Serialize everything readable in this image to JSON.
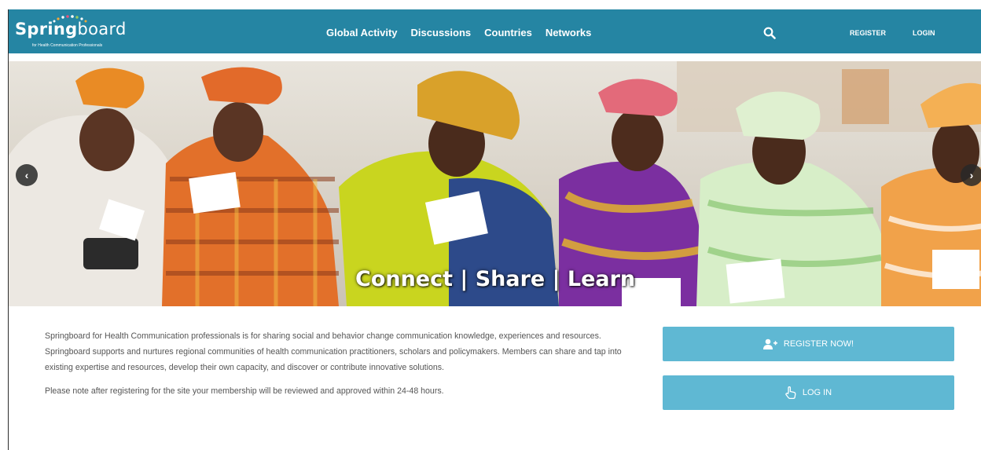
{
  "brand": {
    "logo_text_bold": "Spring",
    "logo_text_rest": "board",
    "tagline": "for Health Communication Professionals",
    "primary_color": "#2585a3",
    "button_color": "#5fb8d3"
  },
  "nav": {
    "items": [
      "Global Activity",
      "Discussions",
      "Countries",
      "Networks"
    ],
    "search_icon": "search-icon",
    "register_label": "REGISTER",
    "login_label": "LOGIN"
  },
  "hero": {
    "caption": "Connect | Share | Learn",
    "prev_icon": "chevron-left-icon",
    "next_icon": "chevron-right-icon"
  },
  "content": {
    "intro": "Springboard for Health Communication professionals is for sharing social and behavior change communication knowledge, experiences and resources. Springboard supports and nurtures regional communities of health communication practitioners, scholars and policymakers. Members can share and tap into existing expertise and resources, develop their own capacity, and discover or contribute innovative solutions.",
    "note": "Please note after registering for the site your membership will be reviewed and approved within 24-48 hours."
  },
  "cta": {
    "register_label": "REGISTER NOW!",
    "register_icon": "add-user-icon",
    "login_label": "LOG IN",
    "login_icon": "pointer-hand-icon"
  }
}
